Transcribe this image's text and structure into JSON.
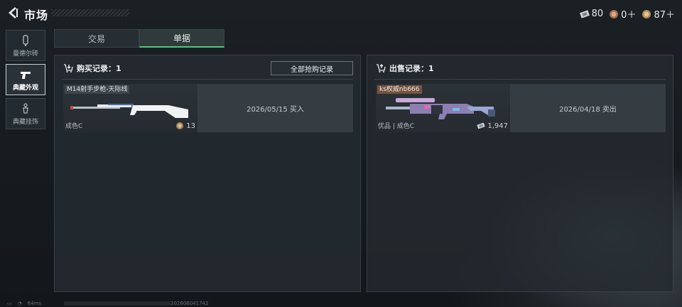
{
  "header": {
    "title": "市场",
    "currencies": [
      {
        "icon": "ticket-icon",
        "value": "80"
      },
      {
        "icon": "coin-icon",
        "value": "0＋"
      },
      {
        "icon": "coin-icon",
        "value": "87＋"
      }
    ]
  },
  "sidebar": {
    "items": [
      {
        "label": "曼德尔砖",
        "icon": "brick-icon",
        "active": false
      },
      {
        "label": "典藏外观",
        "icon": "pistol-icon",
        "active": true
      },
      {
        "label": "典藏挂饰",
        "icon": "charm-icon",
        "active": false
      }
    ]
  },
  "tabs": [
    {
      "label": "交易",
      "active": false
    },
    {
      "label": "单据",
      "active": true
    }
  ],
  "purchase": {
    "heading": "购买记录：1",
    "all_button": "全部抢购记录",
    "record": {
      "name": "M14射手步枪-天际线",
      "quality": "成色C",
      "price": "13",
      "info": "2026/05/15 买入"
    }
  },
  "sale": {
    "heading": "出售记录：1",
    "record": {
      "name": "ks权威nb666",
      "quality": "优品 | 成色C",
      "price": "1,947",
      "info": "2026/04/18 卖出"
    }
  },
  "footer": {
    "ping": "64ms",
    "id": "202606041742"
  },
  "colors": {
    "accent_green": "#4fc77c",
    "background": "#161b20"
  }
}
